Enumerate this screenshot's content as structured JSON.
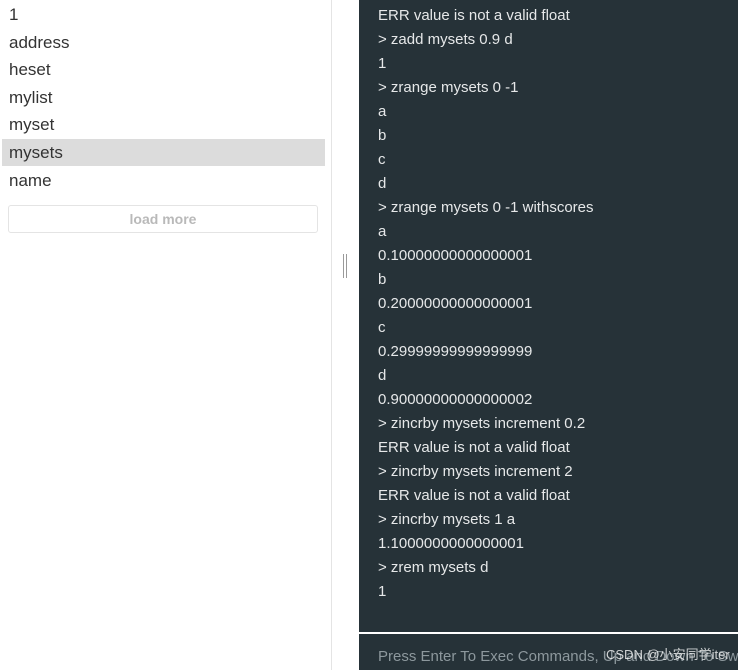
{
  "sidebar": {
    "keys": [
      {
        "label": "1",
        "selected": false
      },
      {
        "label": "address",
        "selected": false
      },
      {
        "label": "heset",
        "selected": false
      },
      {
        "label": "mylist",
        "selected": false
      },
      {
        "label": "myset",
        "selected": false
      },
      {
        "label": "mysets",
        "selected": true
      },
      {
        "label": "name",
        "selected": false
      }
    ],
    "load_more_label": "load more"
  },
  "console": {
    "lines": [
      "ERR value is not a valid float",
      "> zadd mysets 0.9 d",
      "1",
      "> zrange mysets 0 -1",
      "a",
      "b",
      "c",
      "d",
      "> zrange mysets 0 -1 withscores",
      "a",
      "0.10000000000000001",
      "b",
      "0.20000000000000001",
      "c",
      "0.29999999999999999",
      "d",
      "0.90000000000000002",
      "> zincrby mysets increment 0.2",
      "ERR value is not a valid float",
      "> zincrby mysets increment 2",
      "ERR value is not a valid float",
      "> zincrby mysets 1 a",
      "1.1000000000000001",
      "> zrem mysets d",
      "1"
    ],
    "input_placeholder": "Press Enter To Exec Commands, Up and Down To Switch History",
    "input_value": "",
    "watermark": "CSDN @小安同学iter"
  },
  "colors": {
    "console_bg": "#263238",
    "console_text": "#e6e8e9",
    "selected_key_bg": "#dcdcdc"
  }
}
